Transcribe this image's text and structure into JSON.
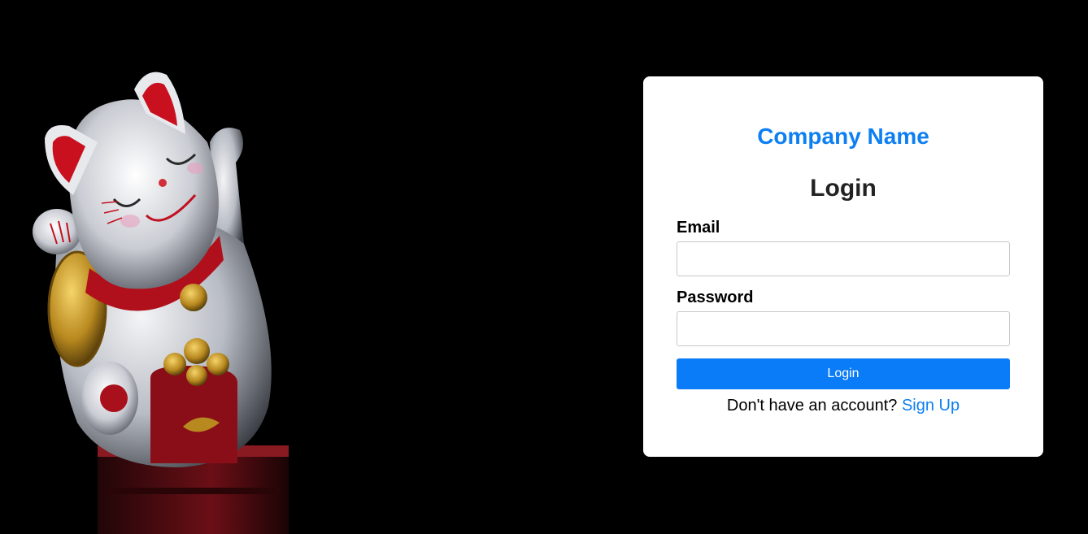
{
  "background": {
    "color": "#000000",
    "image_subject": "maneki-neko lucky cat figurine"
  },
  "brand": {
    "company_name": "Company Name",
    "accent_color": "#0D7FF2"
  },
  "login_form": {
    "heading": "Login",
    "email": {
      "label": "Email",
      "value": "",
      "placeholder": ""
    },
    "password": {
      "label": "Password",
      "value": "",
      "placeholder": ""
    },
    "submit_label": "Login",
    "signup_prompt": "Don't have an account?",
    "signup_link": "Sign Up"
  }
}
